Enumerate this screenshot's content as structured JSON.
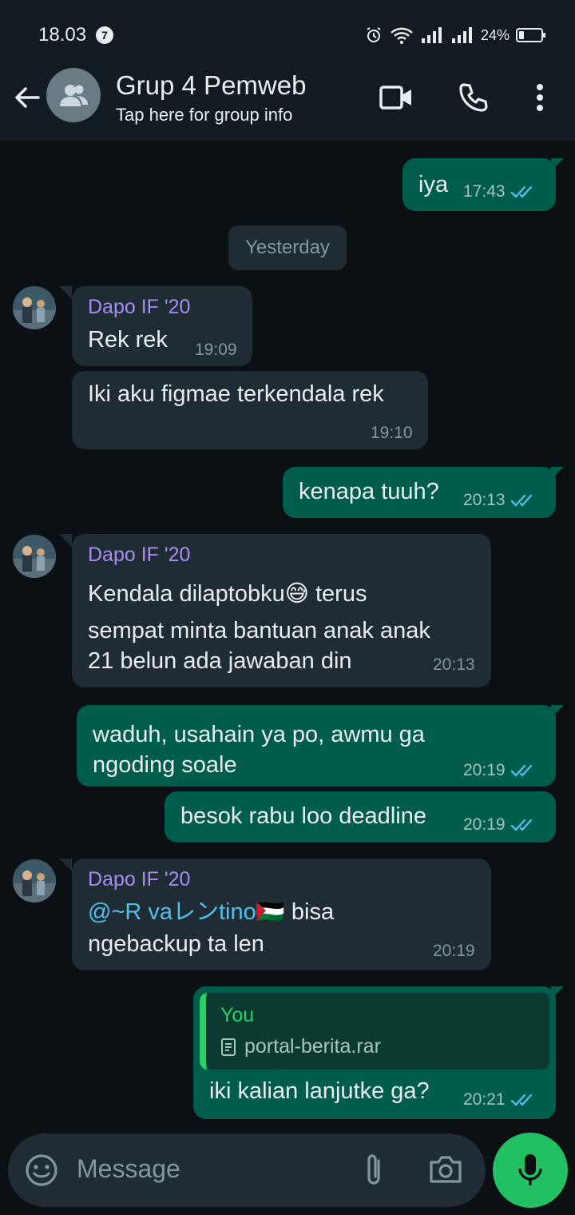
{
  "status_bar": {
    "time": "18.03",
    "notification_count": "7",
    "battery_text": "24%",
    "battery_level": 0.24
  },
  "header": {
    "title": "Grup 4 Pemweb",
    "subtitle": "Tap here for group info",
    "icons": [
      "back-arrow-icon",
      "group-avatar-icon",
      "video-call-icon",
      "phone-icon",
      "more-vert-icon"
    ]
  },
  "chat": {
    "date_divider": "Yesterday",
    "messages": [
      {
        "dir": "out",
        "text": "iya",
        "time": "17:43"
      },
      {
        "dir": "in",
        "sender": "Dapo IF '20",
        "text": "Rek rek",
        "time": "19:09"
      },
      {
        "dir": "in",
        "text": "Iki aku figmae terkendala rek",
        "time": "19:10"
      },
      {
        "dir": "out",
        "text": "kenapa tuuh?",
        "time": "20:13"
      },
      {
        "dir": "in",
        "sender": "Dapo IF '20",
        "lines": [
          "Kendala dilaptobku😅 terus",
          "sempat minta bantuan anak anak",
          "21 belun ada jawaban din"
        ],
        "time": "20:13"
      },
      {
        "dir": "out",
        "lines": [
          "waduh, usahain ya po, awmu ga",
          "ngoding soale"
        ],
        "time": "20:19"
      },
      {
        "dir": "out",
        "text": "besok rabu loo deadline",
        "time": "20:19"
      },
      {
        "dir": "in",
        "sender": "Dapo IF '20",
        "mention": "@~R vaレンtino🇵🇸",
        "mention_after": " bisa",
        "line2": "ngebackup ta len",
        "time": "20:19"
      },
      {
        "dir": "out",
        "quote_name": "You",
        "quote_file": "portal-berita.rar",
        "text": "iki kalian lanjutke ga?",
        "time": "20:21"
      }
    ]
  },
  "input": {
    "placeholder": "Message",
    "icons": [
      "emoji-icon",
      "attach-icon",
      "camera-icon",
      "mic-icon"
    ]
  },
  "colors": {
    "outgoing_bubble": "#005c4b",
    "incoming_bubble": "#202c33",
    "sender_name": "#a88cf5",
    "read_ticks": "#53bdeb",
    "mic_button": "#21c063"
  }
}
